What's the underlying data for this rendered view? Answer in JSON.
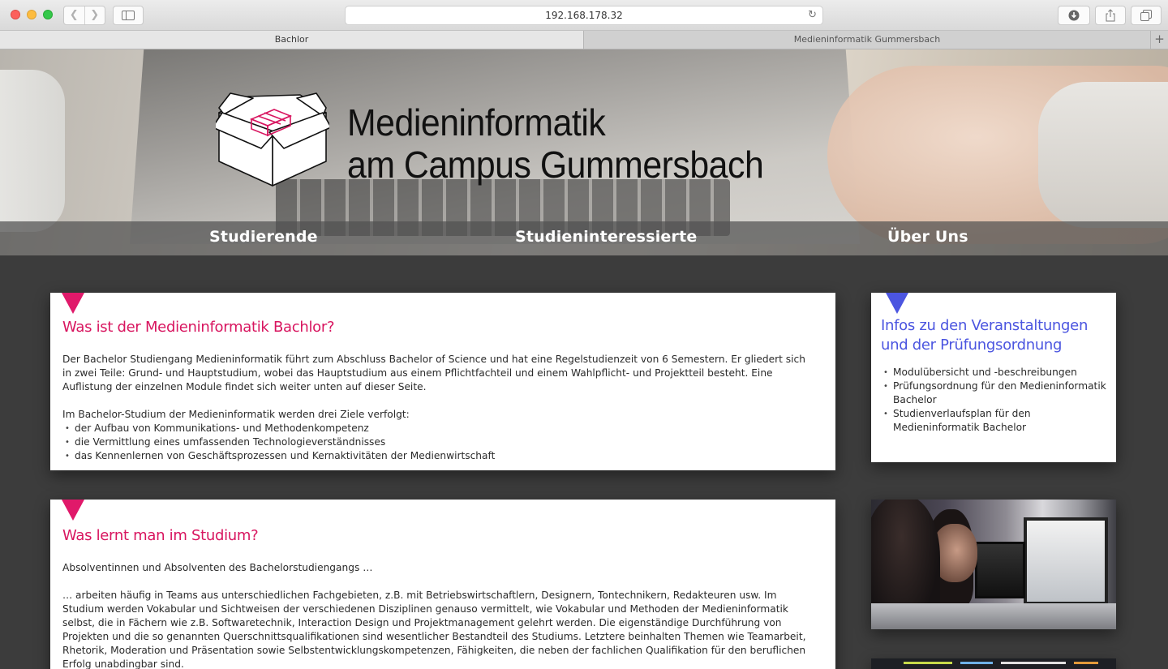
{
  "browser": {
    "address": "192.168.178.32",
    "tabs": [
      {
        "label": "Bachlor",
        "active": true
      },
      {
        "label": "Medieninformatik Gummersbach",
        "active": false
      }
    ],
    "icons": {
      "back": "chevron-left-icon",
      "forward": "chevron-right-icon",
      "sidebar": "sidebar-icon",
      "reload": "reload-icon",
      "downloads": "download-icon",
      "share": "share-icon",
      "tabs": "tabs-overview-icon",
      "new_tab": "plus-icon"
    }
  },
  "hero": {
    "title_line1": "Medieninformatik",
    "title_line2": "am Campus Gummersbach",
    "nav": [
      "Studierende",
      "Studieninteressierte",
      "Über Uns"
    ]
  },
  "colors": {
    "accent_pink": "#d8155f",
    "accent_blue": "#4b55e0",
    "page_background": "#3c3c3c"
  },
  "intro": {
    "title": "Was ist der Medieninformatik Bachlor?",
    "paragraph1": "Der Bachelor Studiengang Medieninformatik führt zum Abschluss Bachelor of Science und hat eine Regelstudienzeit von 6 Semestern. Er gliedert sich in zwei Teile: Grund- und Hauptstudium, wobei das Hauptstudium aus einem Pflichtfachteil und einem Wahlpflicht- und Projektteil besteht. Eine Auflistung der einzelnen Module findet sich weiter unten auf dieser Seite.",
    "paragraph2": "Im Bachelor-Studium der Medieninformatik werden drei Ziele verfolgt:",
    "goals": [
      "der Aufbau von Kommunikations- und Methodenkompetenz",
      "die Vermittlung eines umfassenden Technologieverständnisses",
      "das Kennenlernen von Geschäftsprozessen und Kernaktivitäten der Medienwirtschaft"
    ]
  },
  "study": {
    "title": "Was lernt man im Studium?",
    "paragraph1": "Absolventinnen und Absolventen des Bachelorstudiengangs …",
    "paragraph2": "… arbeiten häufig in Teams aus unterschiedlichen Fachgebieten, z.B. mit Betriebswirtschaftlern, Designern, Tontechnikern, Redakteuren usw. Im Studium werden Vokabular und Sichtweisen der verschiedenen Disziplinen genauso vermittelt, wie Vokabular und Methoden der Medieninformatik selbst, die in Fächern wie z.B. Softwaretechnik, Interaction Design und Projektmanagement gelehrt werden. Die eigenständige Durchführung von Projekten und die so genannten Querschnittsqualifikationen sind wesentlicher Bestandteil des Studiums. Letztere beinhalten Themen wie Teamarbeit, Rhetorik, Moderation und Präsentation sowie Selbstentwicklungskompetenzen, Fähigkeiten, die neben der fachlichen Qualifikation für den beruflichen Erfolg unabdingbar sind."
  },
  "info": {
    "title": "Infos zu den Veranstaltungen und der Prüfungsordnung",
    "links": [
      "Modulübersicht und -beschreibungen",
      "Prüfungsordnung für den Medieninformatik Bachelor",
      "Studienverlaufsplan für den Medieninformatik Bachelor"
    ]
  }
}
